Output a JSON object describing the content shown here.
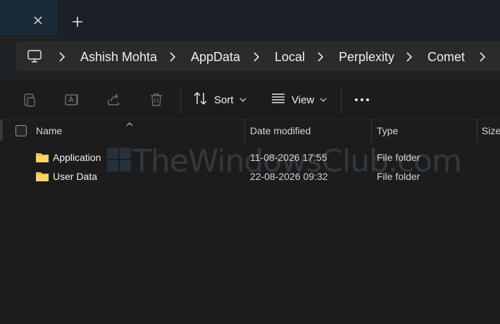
{
  "tabs": {
    "close_icon": "close-icon",
    "new_tab_icon": "plus-icon"
  },
  "address": {
    "root_icon": "this-pc-icon",
    "crumbs": [
      "Ashish Mohta",
      "AppData",
      "Local",
      "Perplexity",
      "Comet"
    ]
  },
  "commandbar": {
    "copy_icon": "copy-icon",
    "rename_icon": "rename-icon",
    "share_icon": "share-icon",
    "delete_icon": "delete-icon",
    "sort_label": "Sort",
    "view_label": "View",
    "more_icon": "more-icon"
  },
  "columns": {
    "name": "Name",
    "date_modified": "Date modified",
    "type": "Type",
    "size": "Size"
  },
  "files": [
    {
      "name": "Application",
      "date": "11-08-2026 17:55",
      "type": "File folder"
    },
    {
      "name": "User Data",
      "date": "22-08-2026 09:32",
      "type": "File folder"
    }
  ],
  "watermark": {
    "text": "TheWindowsClub.com"
  },
  "colors": {
    "folder": "#f0c24a",
    "background": "#1c1c1c",
    "address_field": "#2b2b2b"
  }
}
